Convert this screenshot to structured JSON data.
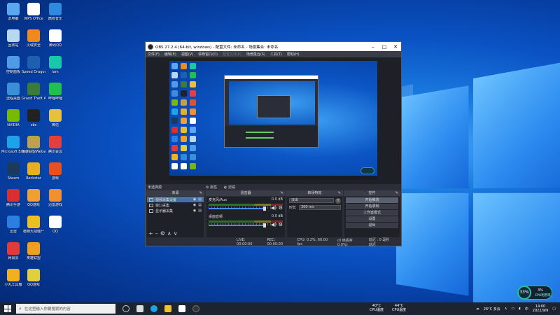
{
  "desktop_icons": [
    {
      "label": "此电脑",
      "color": "#5aa9f0"
    },
    {
      "label": "回收站",
      "color": "#b8d8f0"
    },
    {
      "label": "控制面板",
      "color": "#4f9be8"
    },
    {
      "label": "远程桌面",
      "color": "#3a8fd8"
    },
    {
      "label": "NVIDIA",
      "color": "#76b900"
    },
    {
      "label": "Microsoft Edge",
      "color": "#1fa3e8"
    },
    {
      "label": "Steam",
      "color": "#1b3a5c"
    },
    {
      "label": "腾讯手游",
      "color": "#d83030"
    },
    {
      "label": "迅雷",
      "color": "#2a7fe0"
    },
    {
      "label": "网易云",
      "color": "#e03a3a"
    },
    {
      "label": "小丸工具箱",
      "color": "#f0b020"
    },
    {
      "label": "WPS Office",
      "color": "#ffffff"
    },
    {
      "label": "火绒安全",
      "color": "#f08a20"
    },
    {
      "label": "Speed Dragon",
      "color": "#1e5fb0"
    },
    {
      "label": "Grand Theft Auto V",
      "color": "#3a7a3a"
    },
    {
      "label": "obs",
      "color": "#222222"
    },
    {
      "label": "英雄联盟WeGame",
      "color": "#c0a050"
    },
    {
      "label": "Rockstar",
      "color": "#e8b020"
    },
    {
      "label": "QQ游戏",
      "color": "#f0a030"
    },
    {
      "label": "植物大战僵尸",
      "color": "#e8c020"
    },
    {
      "label": "英雄联盟",
      "color": "#f0a020"
    },
    {
      "label": "QQ游戏",
      "color": "#e0d040"
    },
    {
      "label": "酷狗音乐",
      "color": "#2f8ae0"
    },
    {
      "label": "腾讯QQ",
      "color": "#ffffff"
    },
    {
      "label": "iam",
      "color": "#18c8a8"
    },
    {
      "label": "哔哩哔哩",
      "color": "#20c050"
    },
    {
      "label": "微信",
      "color": "#e8c040"
    },
    {
      "label": "腾讯会议",
      "color": "#e04040"
    },
    {
      "label": "游戏",
      "color": "#e85020"
    },
    {
      "label": "迅雷游戏",
      "color": "#f09030"
    },
    {
      "label": "QQ",
      "color": "#ffffff"
    }
  ],
  "obs": {
    "title": "OBS 27.2.4 (64-bit, windows) - 配置文件: 未命名 - 场景集合: 未命名",
    "menu": [
      "文件(F)",
      "编辑(E)",
      "视图(V)",
      "停靠窗口(D)",
      "配置文件(P)",
      "场景集合(S)",
      "工具(T)",
      "帮助(H)"
    ],
    "menu_disabled_index": 4,
    "scene_status": "未选择源",
    "scene_buttons": [
      "属性",
      "滤镜"
    ],
    "docks": {
      "sources": "来源",
      "mixer": "混音器",
      "transitions": "转场特效",
      "controls": "控件"
    },
    "sources": [
      {
        "name": "视频采集设备",
        "selected": true
      },
      {
        "name": "窗口采集",
        "selected": false
      },
      {
        "name": "显示器采集",
        "selected": false
      }
    ],
    "mixer": [
      {
        "name": "麦克风/Aux",
        "db": "0.0 dB"
      },
      {
        "name": "桌面音频",
        "db": "0.0 dB"
      }
    ],
    "transition": {
      "type": "淡出",
      "duration_label": "时长",
      "duration_value": "300 ms"
    },
    "controls": [
      "开始推流",
      "开始录制",
      "工作室模式",
      "设置",
      "退出"
    ],
    "status": {
      "live": "LIVE: 00:00:00",
      "rec": "REC: 00:00:00",
      "cpu": "CPU: 0.2%, 60.00 fps",
      "fps_extra": "(0 帧丢弃 0.0%)",
      "stats": "延迟 : 0 毫秒延迟"
    }
  },
  "taskbar": {
    "search_placeholder": "在这里输入你要搜索的内容",
    "cpu_temp_value": "40°C",
    "cpu_temp_label": "CPU温度",
    "gpu_temp_value": "44°C",
    "gpu_temp_label": "CPU温度",
    "weather": "26°C 多云",
    "time": "14:00",
    "date": "2022/9/9"
  },
  "cpu_widget": {
    "ring": "33",
    "ring_unit": "%",
    "pct": "3%",
    "label": "CPU利用率"
  }
}
